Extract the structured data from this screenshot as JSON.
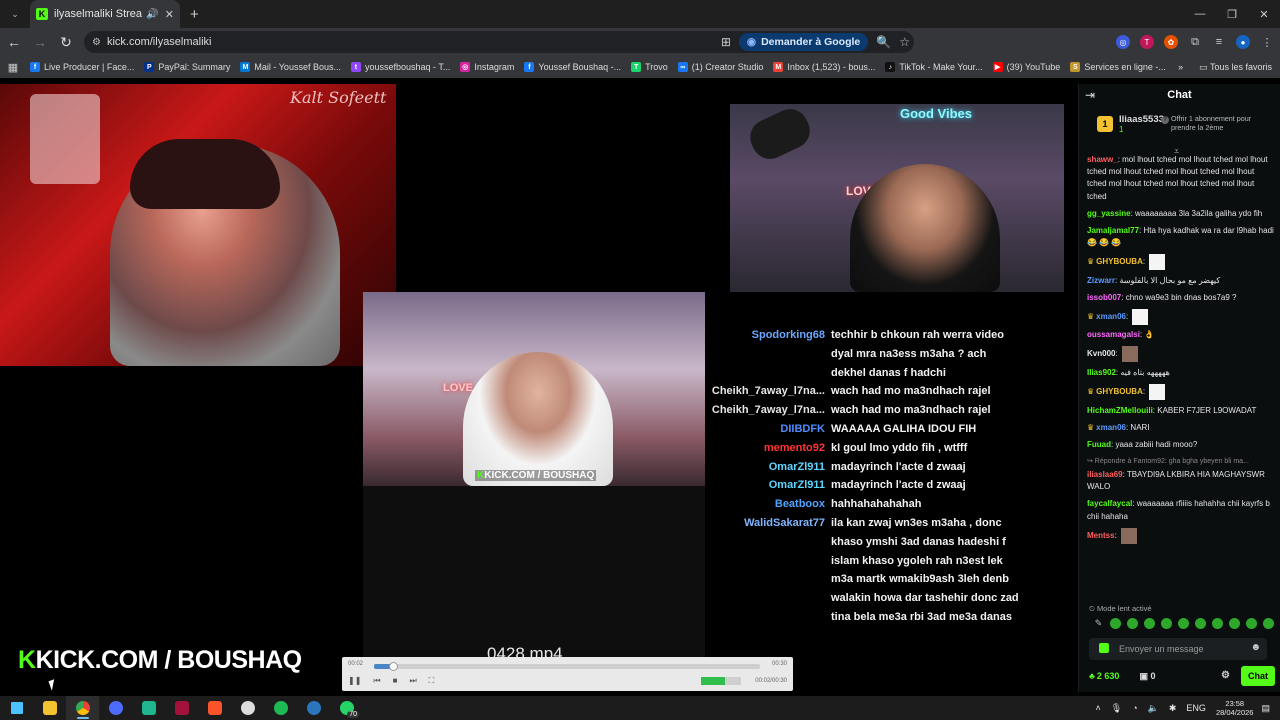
{
  "browser": {
    "tab_title": "ilyaselmaliki Stream - Watch",
    "url": "kick.com/ilyaselmaliki",
    "ask_google": "Demander à Google",
    "bookmarks": [
      {
        "label": "Live Producer | Face...",
        "color": "#1877f2",
        "glyph": "f"
      },
      {
        "label": "PayPal: Summary",
        "color": "#003087",
        "glyph": "P"
      },
      {
        "label": "Mail - Youssef Bous...",
        "color": "#0078d4",
        "glyph": "M"
      },
      {
        "label": "youssefboushaq - T...",
        "color": "#9146ff",
        "glyph": "t"
      },
      {
        "label": "Instagram",
        "color": "#d6249f",
        "glyph": "◎"
      },
      {
        "label": "Youssef Boushaq -...",
        "color": "#1877f2",
        "glyph": "f"
      },
      {
        "label": "Trovo",
        "color": "#19d66b",
        "glyph": "T"
      },
      {
        "label": "(1) Creator Studio",
        "color": "#1877f2",
        "glyph": "∞"
      },
      {
        "label": "Inbox (1,523) - bous...",
        "color": "#ea4335",
        "glyph": "M"
      },
      {
        "label": "TikTok - Make Your...",
        "color": "#111111",
        "glyph": "♪"
      },
      {
        "label": "(39) YouTube",
        "color": "#ff0000",
        "glyph": "▶"
      },
      {
        "label": "Services en ligne -...",
        "color": "#c2962e",
        "glyph": "S"
      }
    ],
    "all_favorites": "Tous les favoris"
  },
  "stream": {
    "cam_sign": "Kalt Sofeett",
    "neon_good_vibes": "Good Vibes",
    "neon_love": "LOVE",
    "mid_watermark_k": "K",
    "mid_watermark": "KICK.COM / BOUSHAQ",
    "big_watermark_k": "K",
    "big_watermark": "KICK.COM / BOUSHAQ",
    "filename": "0428.mp4",
    "player_progress": 0.05,
    "video_chat": [
      {
        "user": "Spodorking68",
        "color": "#68a8ff",
        "msg": "techhir b chkoun rah werra video dyal mra na3ess m3aha ? ach dekhel danas f hadchi"
      },
      {
        "user": "Cheikh_7away_l7na...",
        "color": "#e6e6e6",
        "msg": "wach had mo ma3ndhach rajel"
      },
      {
        "user": "Cheikh_7away_l7na...",
        "color": "#e6e6e6",
        "msg": "wach had mo ma3ndhach rajel"
      },
      {
        "user": "DIIBDFK",
        "color": "#4d8bff",
        "msg": "WAAAAA GALIHA IDOU FIH"
      },
      {
        "user": "memento92",
        "color": "#ff3333",
        "msg": "kI goul lmo yddo fih , wtfff"
      },
      {
        "user": "OmarZl911",
        "color": "#5ed6ff",
        "msg": "madayrinch l'acte d zwaaj"
      },
      {
        "user": "OmarZl911",
        "color": "#5ed6ff",
        "msg": "madayrinch l'acte d zwaaj"
      },
      {
        "user": "Beatboox",
        "color": "#4fa3ff",
        "msg": "hahhahahahahah"
      },
      {
        "user": "WalidSakarat77",
        "color": "#7fb6ff",
        "msg": "ila kan zwaj wn3es m3aha , donc khaso ymshi 3ad danas hadeshi f islam khaso ygoleh rah n3est lek m3a martk wmakib9ash 3leh denb walakin howa dar tashehir donc zad tina bela me3a rbi 3ad me3a danas"
      }
    ]
  },
  "chat": {
    "title": "Chat",
    "gift_user": "Iliaas5533",
    "gift_count": "1",
    "gift_offer": "Offrir 1 abonnement pour prendre la 2ème",
    "messages": [
      {
        "user": "shaww_",
        "color": "#ff5f5f",
        "text": "mol lhout tched mol lhout tched mol lhout tched mol lhout tched mol lhout tched mol lhout tched mol lhout tched mol lhout tched mol lhout tched",
        "emotes": true
      },
      {
        "user": "gg_yassine",
        "color": "#53fc18",
        "text": "waaaaaaaa 3la 3a2ila galiha ydo fih"
      },
      {
        "user": "Jamaljamal77",
        "color": "#53fc18",
        "text": "Hta hya kadhak wa ra dar l9hab hadi 😂 😂 😂"
      },
      {
        "user": "GHYBOUBA",
        "color": "#f2c230",
        "crown": true,
        "pic": "light"
      },
      {
        "user": "Zizwarr",
        "color": "#5b9bff",
        "text": "كيهضر مع مو بحال الا بالفلوسة"
      },
      {
        "user": "issob007",
        "color": "#ff66ff",
        "text": "chno wa9e3 bin dnas bos7a9 ?"
      },
      {
        "user": "xman06",
        "color": "#5b9bff",
        "crown": true,
        "pic": "light"
      },
      {
        "user": "oussamagalsi",
        "color": "#ff66ff",
        "text": "👌"
      },
      {
        "user": "Kvn000",
        "color": "#e6e6e6",
        "pic": "dark"
      },
      {
        "user": "Ilias902",
        "color": "#53fc18",
        "text": "هههههه بتاه فيه"
      },
      {
        "user": "GHYBOUBA",
        "color": "#f2c230",
        "crown": true,
        "pic": "light"
      },
      {
        "user": "HichamZMellouili",
        "color": "#53fc18",
        "text": "KABER F7JER L9OWADAT"
      },
      {
        "user": "xman06",
        "color": "#5b9bff",
        "crown": true,
        "text": "NARI"
      },
      {
        "user": "Fuuad",
        "color": "#53fc18",
        "text": "yaaa zabiii hadi mooo?"
      },
      {
        "reply": "↪ Répondre à Fantom92: gha bgha ybeyen bli ma..."
      },
      {
        "user": "iliaslaa69",
        "color": "#ff5f5f",
        "text": "TBAYDI9A LKBIRA HIA MAGHAYSWR WALO"
      },
      {
        "user": "faycalfaycal",
        "color": "#53fc18",
        "text": "waaaaaaa rfiiiis hahahha chii kayrfs b chii hahaha"
      },
      {
        "user": "Mentss",
        "color": "#ff5f5f",
        "pic": "dark"
      }
    ],
    "slow_mode": "Mode lent activé",
    "input_placeholder": "Envoyer un message",
    "points": "2 630",
    "gift_subs": "0",
    "send_label": "Chat"
  },
  "taskbar": {
    "whatsapp_badge": "70",
    "lang": "ENG",
    "time": "23:58",
    "date": "28/04/2026"
  }
}
